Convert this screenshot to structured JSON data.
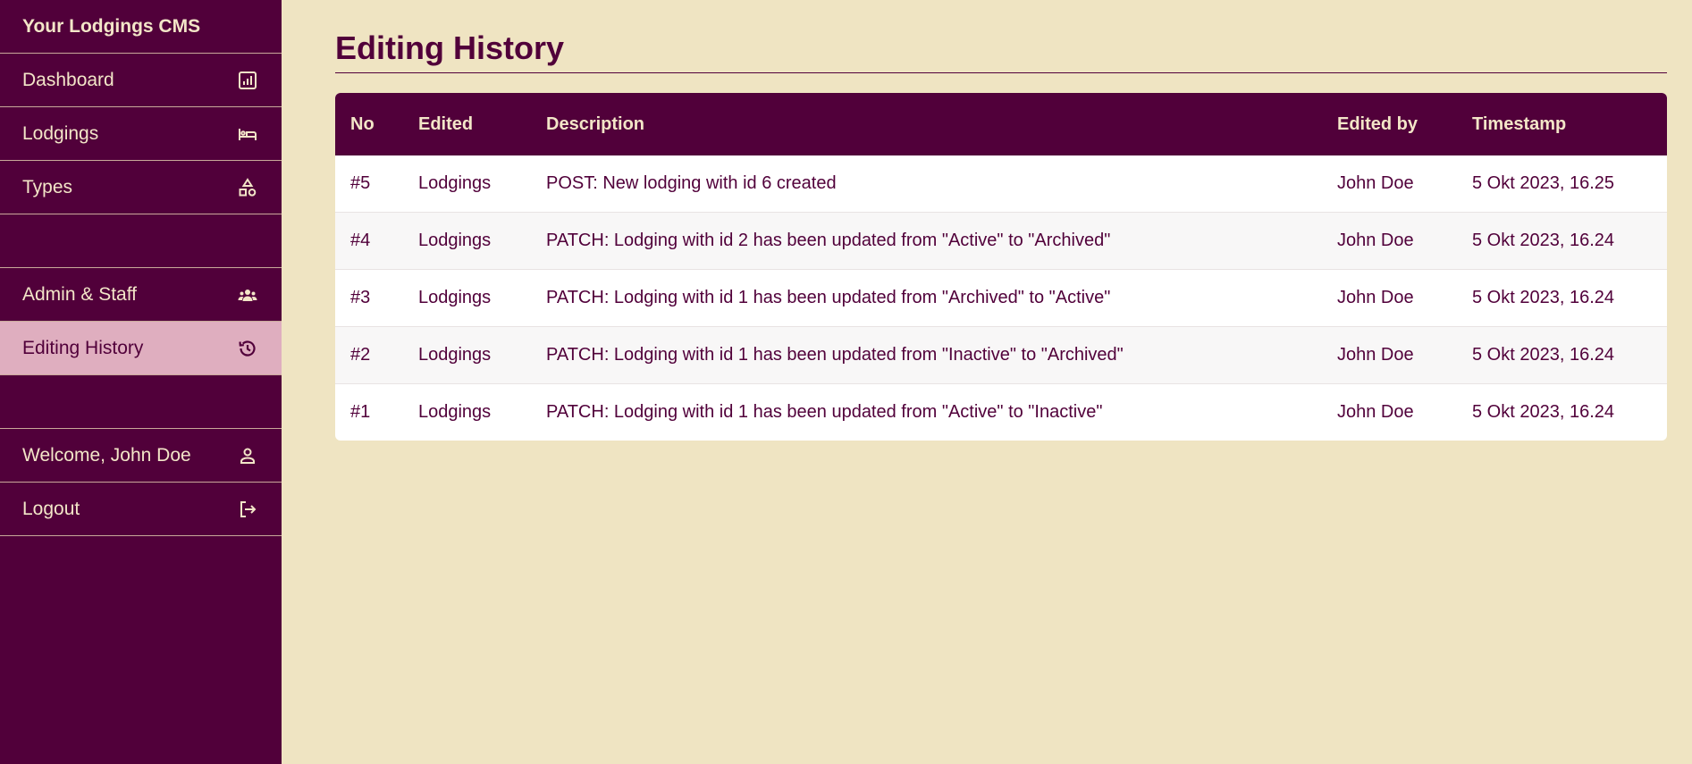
{
  "sidebar": {
    "brand": "Your Lodgings CMS",
    "nav": [
      {
        "label": "Dashboard",
        "icon": "chart-icon"
      },
      {
        "label": "Lodgings",
        "icon": "bed-icon"
      },
      {
        "label": "Types",
        "icon": "shapes-icon"
      }
    ],
    "admin": [
      {
        "label": "Admin & Staff",
        "icon": "users-icon"
      },
      {
        "label": "Editing History",
        "icon": "history-icon",
        "active": true
      }
    ],
    "account": [
      {
        "label": "Welcome, John Doe",
        "icon": "user-icon"
      },
      {
        "label": "Logout",
        "icon": "logout-icon"
      }
    ]
  },
  "main": {
    "title": "Editing History",
    "table": {
      "headers": [
        "No",
        "Edited",
        "Description",
        "Edited by",
        "Timestamp"
      ],
      "rows": [
        {
          "no": "#5",
          "edited": "Lodgings",
          "description": "POST: New lodging with id 6 created",
          "by": "John Doe",
          "timestamp": "5 Okt 2023, 16.25"
        },
        {
          "no": "#4",
          "edited": "Lodgings",
          "description": "PATCH: Lodging with id 2 has been updated from \"Active\" to \"Archived\"",
          "by": "John Doe",
          "timestamp": "5 Okt 2023, 16.24"
        },
        {
          "no": "#3",
          "edited": "Lodgings",
          "description": "PATCH: Lodging with id 1 has been updated from \"Archived\" to \"Active\"",
          "by": "John Doe",
          "timestamp": "5 Okt 2023, 16.24"
        },
        {
          "no": "#2",
          "edited": "Lodgings",
          "description": "PATCH: Lodging with id 1 has been updated from \"Inactive\" to \"Archived\"",
          "by": "John Doe",
          "timestamp": "5 Okt 2023, 16.24"
        },
        {
          "no": "#1",
          "edited": "Lodgings",
          "description": "PATCH: Lodging with id 1 has been updated from \"Active\" to \"Inactive\"",
          "by": "John Doe",
          "timestamp": "5 Okt 2023, 16.24"
        }
      ]
    }
  },
  "colors": {
    "sidebar_bg": "#51003a",
    "active_bg": "#dfaebf",
    "page_bg": "#efe4c2",
    "text_light": "#f3e6c8"
  }
}
